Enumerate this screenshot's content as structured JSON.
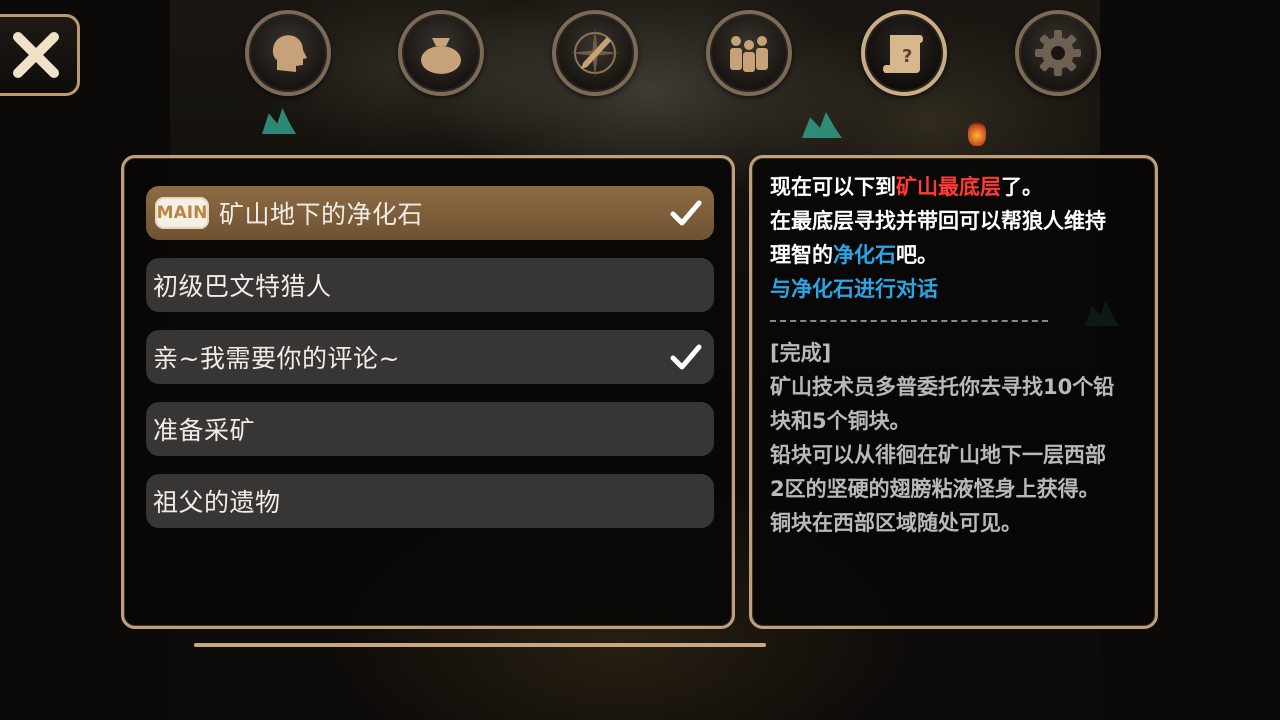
{
  "nav": {
    "close_label": "close",
    "tabs": [
      {
        "icon": "character-head-icon"
      },
      {
        "icon": "item-bag-icon"
      },
      {
        "icon": "skill-compass-sword-icon"
      },
      {
        "icon": "party-people-icon"
      },
      {
        "icon": "quest-scroll-icon",
        "active": true
      },
      {
        "icon": "settings-gear-icon"
      }
    ]
  },
  "quests": [
    {
      "badge": "MAIN",
      "label": "矿山地下的净化石",
      "completed": true,
      "selected": true
    },
    {
      "label": "初级巴文特猎人",
      "completed": false
    },
    {
      "label": "亲~我需要你的评论~",
      "completed": true
    },
    {
      "label": "准备采矿",
      "completed": false
    },
    {
      "label": "祖父的遗物",
      "completed": false
    }
  ],
  "detail": {
    "line1_pre": "现在可以下到",
    "line1_highlight": "矿山最底层",
    "line1_post": "了。",
    "line2": "在最底层寻找并带回可以帮狼人维持",
    "line3_pre": "理智的",
    "line3_highlight": "净化石",
    "line3_post": "吧。",
    "objective": "与净化石进行对话",
    "completed_header": "[完成]",
    "completed_lines": [
      "矿山技术员多普委托你去寻找10个铅",
      "块和5个铜块。",
      "铅块可以从徘徊在矿山地下一层西部",
      "2区的坚硬的翅膀粘液怪身上获得。",
      "铜块在西部区域随处可见。"
    ]
  },
  "colors": {
    "accent_border": "#bfa07a",
    "highlight_red": "#ff3b36",
    "highlight_blue": "#2aa6e8",
    "selected_row": "#8d6c45"
  }
}
